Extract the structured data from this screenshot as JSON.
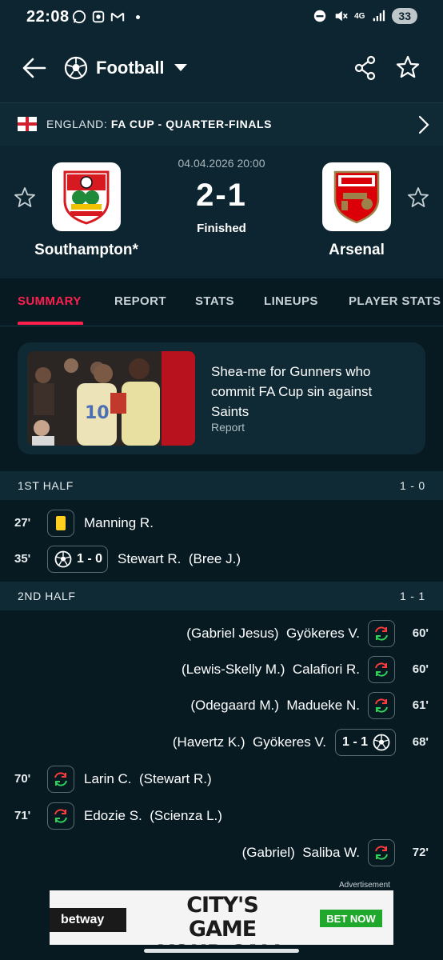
{
  "status_bar": {
    "time": "22:08",
    "network": "4G",
    "battery": "33"
  },
  "header": {
    "sport": "Football",
    "icons": [
      "arrow-back-icon",
      "football-icon",
      "chevron-down-icon",
      "share-icon",
      "star-icon"
    ]
  },
  "competition": {
    "country": "ENGLAND:",
    "name": "FA CUP - QUARTER-FINALS"
  },
  "match": {
    "datetime": "04.04.2026 20:00",
    "score": "2-1",
    "status": "Finished",
    "home": {
      "name": "Southampton*"
    },
    "away": {
      "name": "Arsenal"
    }
  },
  "tabs": [
    "SUMMARY",
    "REPORT",
    "STATS",
    "LINEUPS",
    "PLAYER STATS"
  ],
  "news": {
    "title": "Shea-me for Gunners who commit FA Cup sin against Saints",
    "source": "Report"
  },
  "first_half": {
    "label": "1ST HALF",
    "score": "1 - 0",
    "events": [
      {
        "minute": "27'",
        "side": "home",
        "type": "yellow-card",
        "player": "Manning R.",
        "detail": ""
      },
      {
        "minute": "35'",
        "side": "home",
        "type": "goal",
        "score": "1 - 0",
        "player": "Stewart R.",
        "detail": "(Bree J.)"
      }
    ]
  },
  "second_half": {
    "label": "2ND HALF",
    "score": "1 - 1",
    "events": [
      {
        "minute": "60'",
        "side": "away",
        "type": "substitution",
        "player": "Gyökeres V.",
        "detail": "(Gabriel Jesus)"
      },
      {
        "minute": "60'",
        "side": "away",
        "type": "substitution",
        "player": "Calafiori R.",
        "detail": "(Lewis-Skelly M.)"
      },
      {
        "minute": "61'",
        "side": "away",
        "type": "substitution",
        "player": "Madueke N.",
        "detail": "(Odegaard M.)"
      },
      {
        "minute": "68'",
        "side": "away",
        "type": "goal",
        "score": "1 - 1",
        "player": "Gyökeres V.",
        "detail": "(Havertz K.)"
      },
      {
        "minute": "70'",
        "side": "home",
        "type": "substitution",
        "player": "Larin C.",
        "detail": "(Stewart R.)"
      },
      {
        "minute": "71'",
        "side": "home",
        "type": "substitution",
        "player": "Edozie S.",
        "detail": "(Scienza L.)"
      },
      {
        "minute": "72'",
        "side": "away",
        "type": "substitution",
        "player": "Saliba W.",
        "detail": "(Gabriel)"
      }
    ]
  },
  "ad": {
    "label": "Advertisement",
    "brand": "betway",
    "headline": "CITY'S GAME YOUR CALL",
    "cta": "BET NOW"
  },
  "colors": {
    "background": "#071a22",
    "accent": "#ff1f4f",
    "yellow_card": "#ffcf1f",
    "sub_in": "#2fd15a",
    "sub_out": "#ff3b3b"
  }
}
